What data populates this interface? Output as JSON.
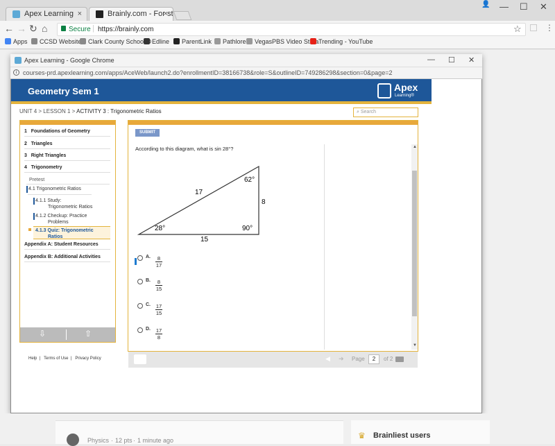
{
  "browser": {
    "tabs": [
      {
        "label": "Apex Learning"
      },
      {
        "label": "Brainly.com - For studen"
      }
    ],
    "tab_close": "×",
    "window_controls": {
      "user": "👤",
      "minimize": "—",
      "maximize": "☐",
      "close": "✕"
    },
    "nav": {
      "back": "←",
      "forward": "→",
      "reload": "↻",
      "home": "⌂"
    },
    "address": {
      "secure_label": "Secure",
      "url": "https://brainly.com"
    },
    "star": "☆",
    "bookmarks": [
      {
        "label": "Apps",
        "color": "#4285f4"
      },
      {
        "label": "CCSD Websites",
        "color": "#888"
      },
      {
        "label": "Clark County School D",
        "color": "#888"
      },
      {
        "label": "Edline",
        "color": "#333"
      },
      {
        "label": "ParentLink",
        "color": "#222"
      },
      {
        "label": "Pathlore",
        "color": "#999"
      },
      {
        "label": "VegasPBS Video Strea",
        "color": "#999"
      },
      {
        "label": "Trending - YouTube",
        "color": "#e62117"
      }
    ]
  },
  "popup": {
    "title": "Apex Learning - Google Chrome",
    "controls": {
      "minimize": "—",
      "maximize": "☐",
      "close": "✕"
    },
    "url": "courses-prd.apexlearning.com/apps/AceWeb/launch2.do?enrollmentID=38166738&role=S&outlineID=749286298&section=0&page=2",
    "course_title": "Geometry  Sem 1",
    "logo_text": "Apex",
    "logo_sub": "Learning®",
    "breadcrumb": {
      "prefix": "UNIT 4 > LESSON 1 > ",
      "current": "ACTIVITY 3 : Trigonometric Ratios"
    },
    "search_placeholder": "Search",
    "nav": {
      "units": [
        {
          "num": "1",
          "label": "Foundations of Geometry"
        },
        {
          "num": "2",
          "label": "Triangles"
        },
        {
          "num": "3",
          "label": "Right Triangles"
        },
        {
          "num": "4",
          "label": "Trigonometry"
        }
      ],
      "pretest": "Pretest",
      "lesson": "4.1   Trigonometric Ratios",
      "activities": [
        {
          "num": "4.1.1",
          "line1": "Study:",
          "line2": "Trigonometric Ratios"
        },
        {
          "num": "4.1.2",
          "line1": "Checkup: Practice",
          "line2": "Problems"
        },
        {
          "num": "4.1.3",
          "line1": "Quiz: Trigonometric",
          "line2": "Ratios"
        }
      ],
      "appendix_a": "Appendix A: Student Resources",
      "appendix_b": "Appendix B: Additional Activities",
      "down_arrow": "⇩",
      "up_arrow": "⇧"
    },
    "footer_links": [
      "Help",
      "Terms of Use",
      "Privacy Policy"
    ],
    "footer_sep": "|",
    "submit_label": "SUBMIT",
    "question": "According to this diagram, what is sin 28°?",
    "diagram": {
      "hyp": "17",
      "opp": "8",
      "adj": "15",
      "angle_top": "62°",
      "angle_left": "28°",
      "angle_right": "90°"
    },
    "choices": [
      {
        "letter": "A.",
        "num": "8",
        "den": "17"
      },
      {
        "letter": "B.",
        "num": "8",
        "den": "15"
      },
      {
        "letter": "C.",
        "num": "17",
        "den": "15"
      },
      {
        "letter": "D.",
        "num": "17",
        "den": "8"
      }
    ],
    "pager": {
      "label": "Page",
      "value": "2",
      "of": "of 2"
    }
  },
  "brainly": {
    "subject": "Physics",
    "points": "12 pts",
    "time": "1 minute ago",
    "brainliest": "Brainliest users"
  }
}
